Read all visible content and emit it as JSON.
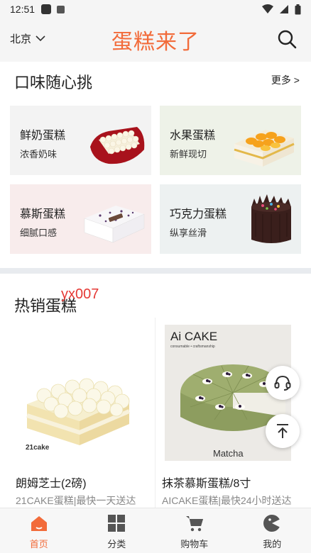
{
  "status_bar": {
    "time": "12:51"
  },
  "header": {
    "city": "北京",
    "title": "蛋糕来了"
  },
  "flavor_section": {
    "title": "口味随心挑",
    "more": "更多 >",
    "cards": [
      {
        "name": "鲜奶蛋糕",
        "desc": "浓香奶味",
        "bg": "#f3f3f3"
      },
      {
        "name": "水果蛋糕",
        "desc": "新鲜现切",
        "bg": "#eef2e8"
      },
      {
        "name": "慕斯蛋糕",
        "desc": "细腻口感",
        "bg": "#f8ecec"
      },
      {
        "name": "巧克力蛋糕",
        "desc": "纵享丝滑",
        "bg": "#edf1f1"
      }
    ]
  },
  "hot_section": {
    "title": "热销蛋糕",
    "watermark": "yx007",
    "products": [
      {
        "name": "朗姆芝士(2磅)",
        "desc": "21CAKE蛋糕|最快一天送达",
        "brand": "21cake"
      },
      {
        "name": "抹茶慕斯蛋糕/8寸",
        "desc": "AICAKE蛋糕|最快24小时送达",
        "brand": "Ai CAKE",
        "brand_sub": "consumable • craftsmanship",
        "img_caption": "Matcha"
      }
    ]
  },
  "tabbar": {
    "tabs": [
      {
        "label": "首页",
        "active": true
      },
      {
        "label": "分类",
        "active": false
      },
      {
        "label": "购物车",
        "active": false
      },
      {
        "label": "我的",
        "active": false
      }
    ]
  },
  "colors": {
    "accent": "#f26b3a",
    "watermark": "#e53935"
  }
}
